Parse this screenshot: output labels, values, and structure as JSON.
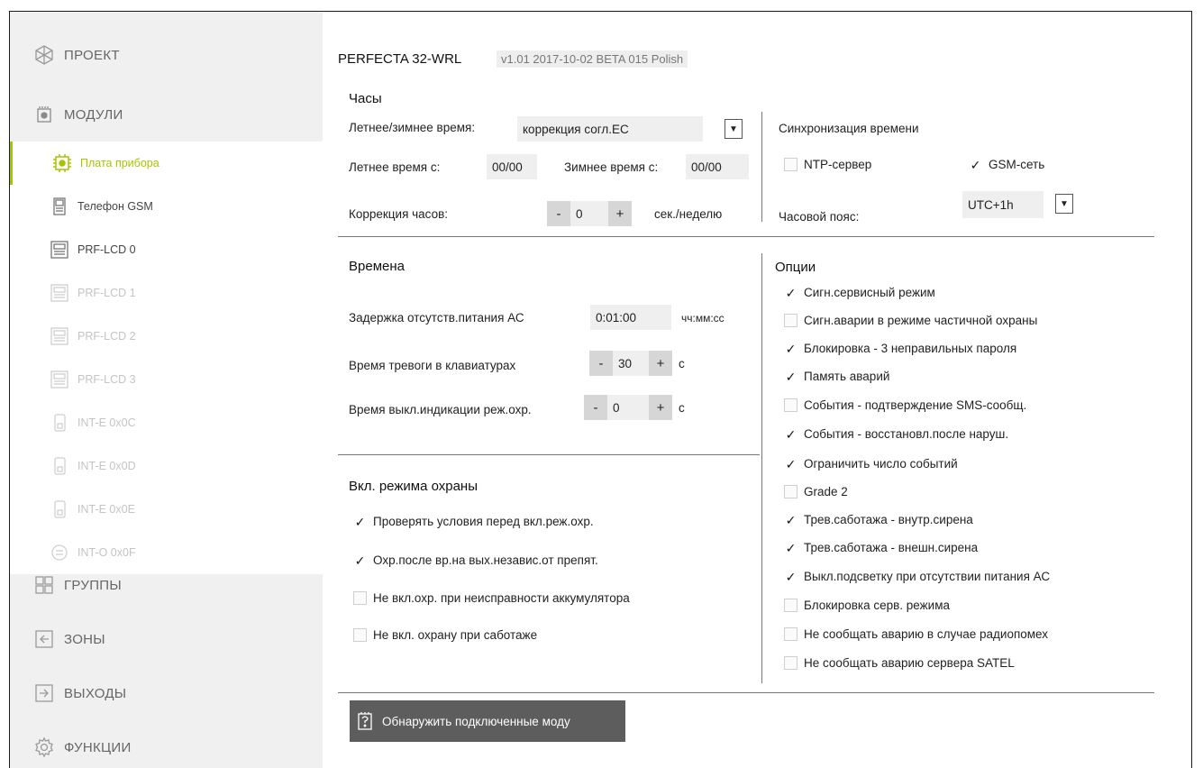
{
  "sidebar": {
    "project": {
      "label": "ПРОЕКТ",
      "icon": "project-icon"
    },
    "modules": {
      "label": "МОДУЛИ",
      "icon": "modules-icon"
    },
    "submodules": [
      {
        "label": "Плата прибора",
        "icon": "board-icon",
        "state": "active"
      },
      {
        "label": "Телефон GSM",
        "icon": "phone-icon",
        "state": "normal"
      },
      {
        "label": "PRF-LCD 0",
        "icon": "keypad-icon",
        "state": "normal"
      },
      {
        "label": "PRF-LCD 1",
        "icon": "keypad-icon",
        "state": "dim"
      },
      {
        "label": "PRF-LCD 2",
        "icon": "keypad-icon",
        "state": "dim"
      },
      {
        "label": "PRF-LCD 3",
        "icon": "keypad-icon",
        "state": "dim"
      },
      {
        "label": "INT-E 0x0C",
        "icon": "expander-icon",
        "state": "dim"
      },
      {
        "label": "INT-E 0x0D",
        "icon": "expander-icon",
        "state": "dim"
      },
      {
        "label": "INT-E 0x0E",
        "icon": "expander-icon",
        "state": "dim"
      },
      {
        "label": "INT-O 0x0F",
        "icon": "output-module-icon",
        "state": "dim"
      }
    ],
    "groups": {
      "label": "ГРУППЫ",
      "icon": "groups-icon"
    },
    "zones": {
      "label": "ЗОНЫ",
      "icon": "zones-icon"
    },
    "outputs": {
      "label": "ВЫХОДЫ",
      "icon": "outputs-icon"
    },
    "functions": {
      "label": "ФУНКЦИИ",
      "icon": "gear-icon"
    }
  },
  "header": {
    "title": "PERFECTA 32-WRL",
    "version": "v1.01 2017-10-02 BETA 015 Polish"
  },
  "clock": {
    "title": "Часы",
    "dst_label": "Летнее/зимнее время:",
    "dst_value": "коррекция согл.ЕС",
    "summer_label": "Летнее время с:",
    "summer_value": "00/00",
    "winter_label": "Зимнее время с:",
    "winter_value": "00/00",
    "correction_label": "Коррекция часов:",
    "correction_value": "0",
    "correction_unit": "сек./неделю",
    "minus": "-",
    "plus": "+"
  },
  "sync": {
    "title": "Синхронизация времени",
    "ntp_label": "NTP-сервер",
    "ntp_checked": false,
    "gsm_label": "GSM-сеть",
    "gsm_checked": true,
    "tz_label": "Часовой пояс:",
    "tz_value": "UTC+1h"
  },
  "times": {
    "title": "Времена",
    "ac_delay_label": "Задержка отсутств.питания АС",
    "ac_delay_value": "0:01:00",
    "ac_delay_unit": "чч:мм:сс",
    "alarm_kp_label": "Время тревоги в клавиатурах",
    "alarm_kp_value": "30",
    "alarm_kp_unit": "с",
    "arm_ind_label": "Время выкл.индикации реж.охр.",
    "arm_ind_value": "0",
    "arm_ind_unit": "с"
  },
  "arming": {
    "title": "Вкл. режима охраны",
    "options": [
      {
        "label": "Проверять условия перед вкл.реж.охр.",
        "checked": true
      },
      {
        "label": "Охр.после вр.на вых.независ.от препят.",
        "checked": true
      },
      {
        "label": "Не вкл.охр. при неисправности аккумулятора",
        "checked": false
      },
      {
        "label": "Не вкл. охрану при саботаже",
        "checked": false
      }
    ]
  },
  "options": {
    "title": "Опции",
    "items": [
      {
        "label": "Сигн.сервисный режим",
        "checked": true
      },
      {
        "label": "Сигн.аварии в режиме частичной охраны",
        "checked": false
      },
      {
        "label": "Блокировка - 3 неправильных пароля",
        "checked": true
      },
      {
        "label": "Память аварий",
        "checked": true
      },
      {
        "label": "События - подтверждение SMS-сообщ.",
        "checked": false
      },
      {
        "label": "События - восстановл.после наруш.",
        "checked": true
      },
      {
        "label": "Ограничить число событий",
        "checked": true
      },
      {
        "label": "Grade 2",
        "checked": false
      },
      {
        "label": "Трев.саботажа - внутр.сирена",
        "checked": true
      },
      {
        "label": "Трев.саботажа - внешн.сирена",
        "checked": true
      },
      {
        "label": "Выкл.подсветку при отсутствии питания АС",
        "checked": true
      },
      {
        "label": "Блокировка серв. режима",
        "checked": false
      },
      {
        "label": "Не сообщать аварию в случае радиопомех",
        "checked": false
      },
      {
        "label": "Не сообщать аварию сервера SATEL",
        "checked": false
      }
    ]
  },
  "detect_button": {
    "label": "Обнаружить подключенные моду",
    "icon": "detect-modules-icon"
  },
  "colors": {
    "accent": "#a8c400",
    "sidebar_bg": "#f0f0f0",
    "button_bg": "#5d5d5d"
  }
}
